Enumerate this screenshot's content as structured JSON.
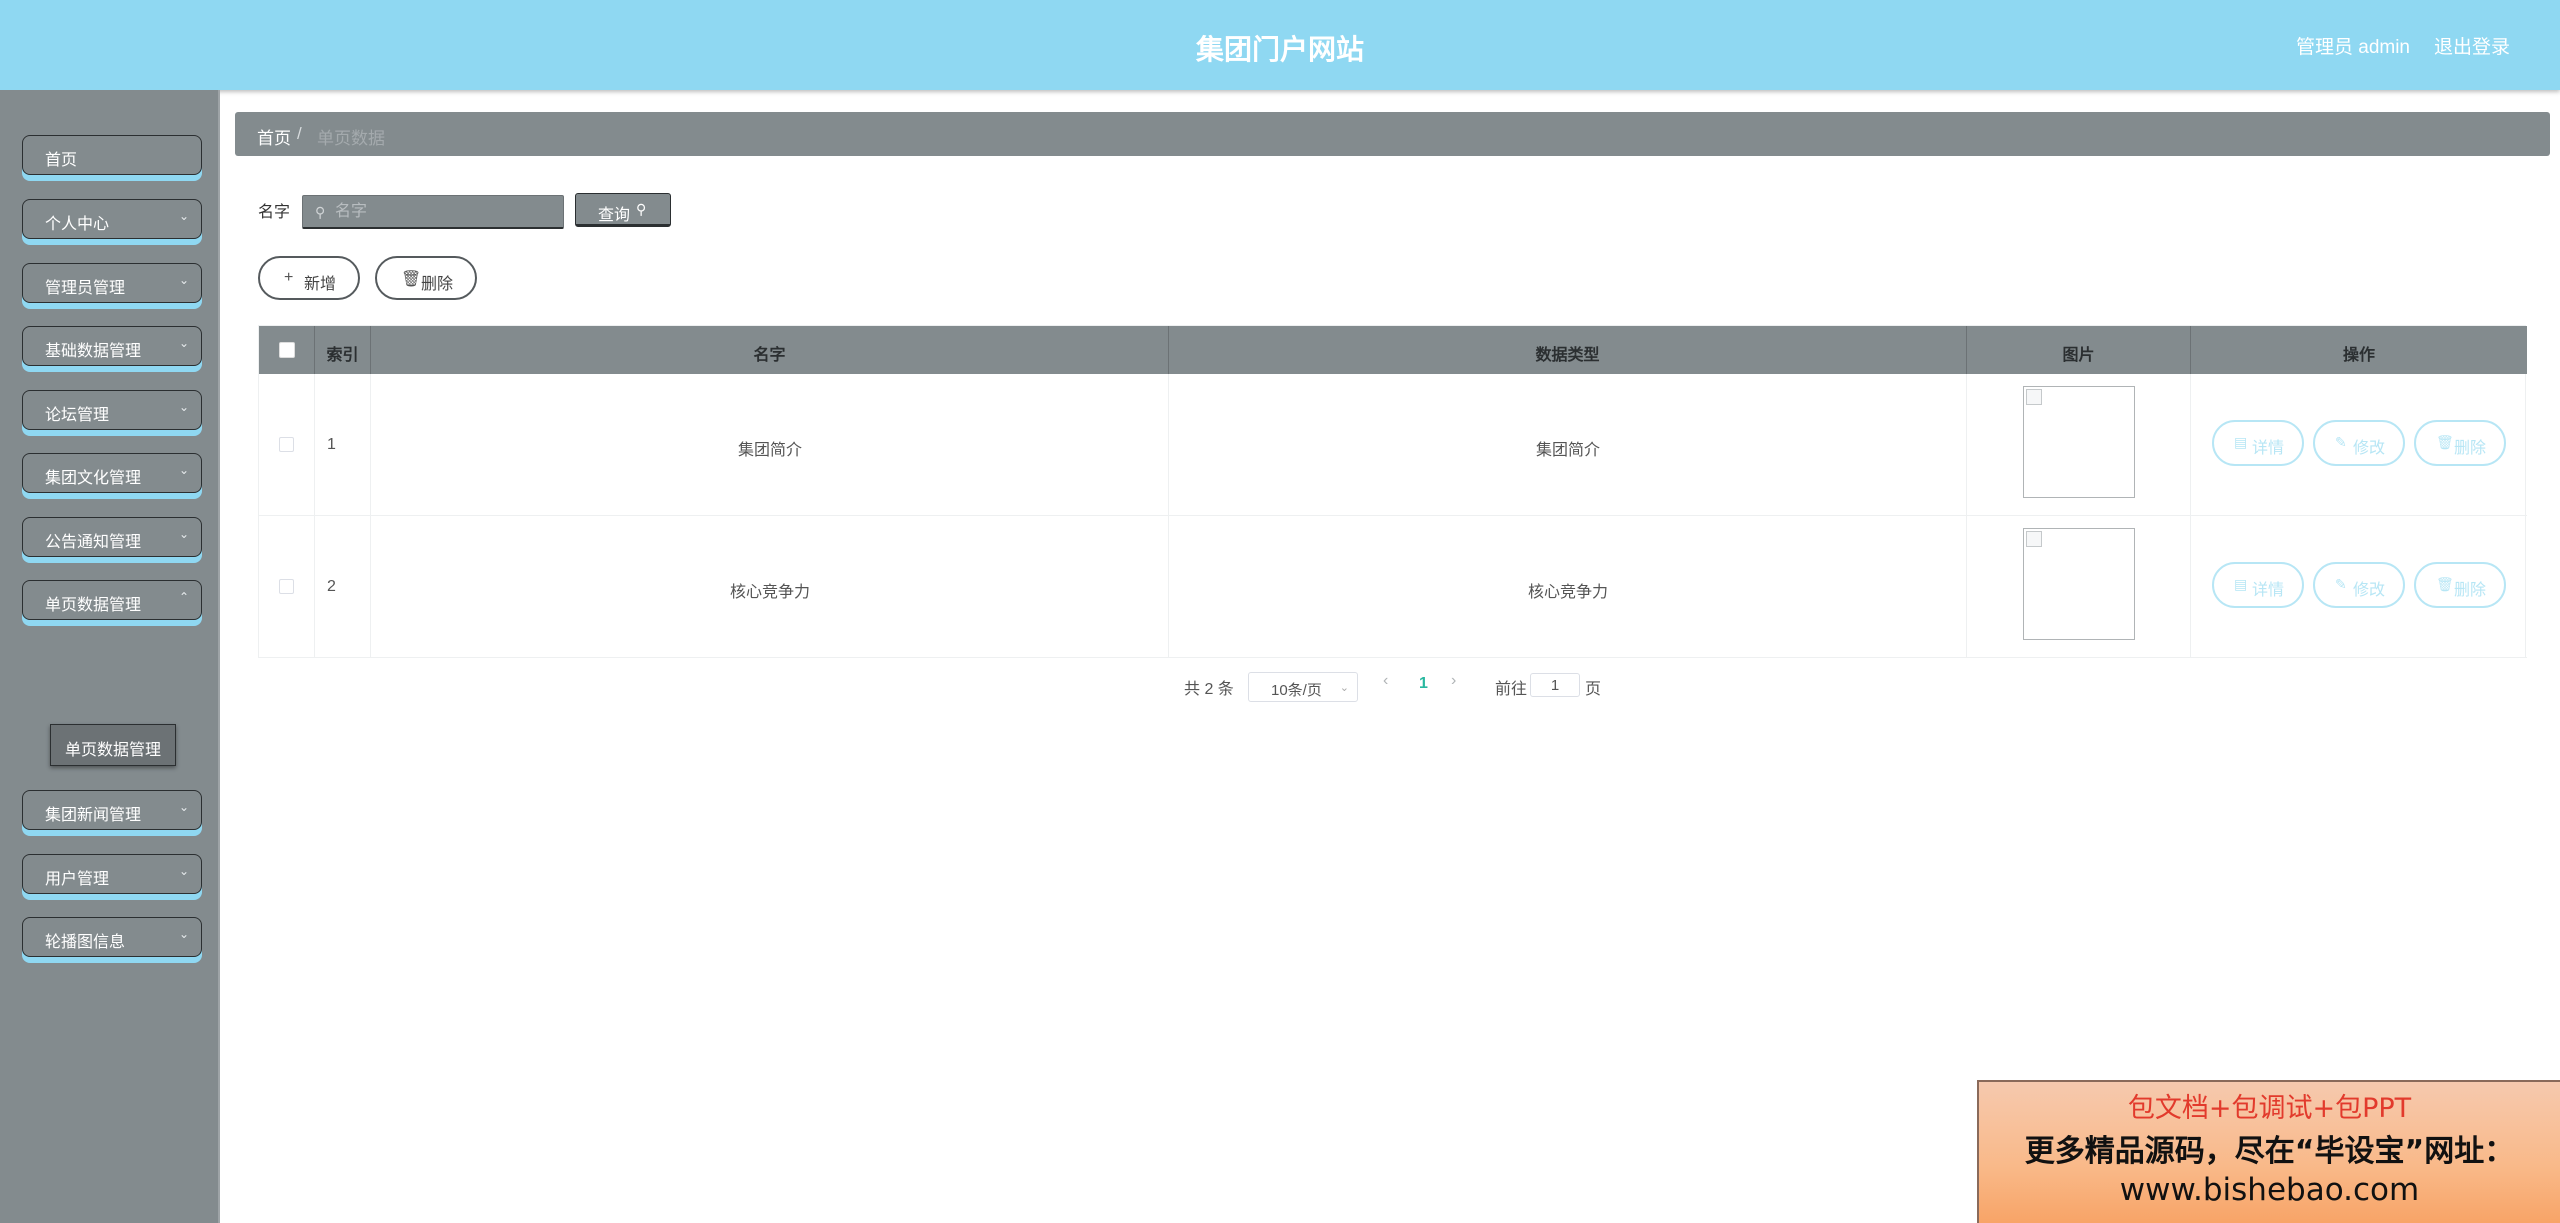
{
  "header": {
    "title": "集团门户网站",
    "user": "管理员 admin",
    "logout": "退出登录"
  },
  "sidebar": {
    "items": [
      {
        "label": "首页"
      },
      {
        "label": "个人中心"
      },
      {
        "label": "管理员管理"
      },
      {
        "label": "基础数据管理"
      },
      {
        "label": "论坛管理"
      },
      {
        "label": "集团文化管理"
      },
      {
        "label": "公告通知管理"
      },
      {
        "label": "单页数据管理"
      },
      {
        "label": "集团新闻管理"
      },
      {
        "label": "用户管理"
      },
      {
        "label": "轮播图信息"
      }
    ],
    "submenu": {
      "label": "单页数据管理"
    }
  },
  "breadcrumb": {
    "home": "首页",
    "separator": "/",
    "current": "单页数据"
  },
  "search": {
    "label": "名字",
    "placeholder": "名字",
    "query_button": "查询"
  },
  "actions": {
    "add": "新增",
    "delete": "删除"
  },
  "table": {
    "columns": [
      "索引",
      "名字",
      "数据类型",
      "图片",
      "操作"
    ],
    "rows": [
      {
        "index": "1",
        "name": "集团简介",
        "type": "集团简介"
      },
      {
        "index": "2",
        "name": "核心竞争力",
        "type": "核心竞争力"
      }
    ],
    "row_actions": {
      "detail": "详情",
      "edit": "修改",
      "delete": "删除"
    }
  },
  "pagination": {
    "total": "共 2 条",
    "page_size": "10条/页",
    "current_page": "1",
    "goto_label": "前往",
    "goto_value": "1",
    "page_unit": "页"
  },
  "watermark": {
    "line1": "包文档+包调试+包PPT",
    "line2": "更多精品源码，尽在“毕设宝”网址：",
    "line3": "www.bishebao.com"
  },
  "colors": {
    "header_bg": "#8fd8f2",
    "sidebar_bg": "#838b8e",
    "accent": "#8fd8f2",
    "pager_active": "#2ab8a0"
  }
}
